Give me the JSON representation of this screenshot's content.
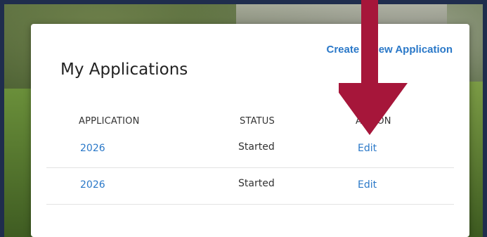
{
  "card": {
    "title": "My Applications",
    "create_link": "Create a New Application"
  },
  "table": {
    "headers": {
      "application": "APPLICATION",
      "status": "STATUS",
      "action": "ACTION"
    },
    "rows": [
      {
        "application": "2026",
        "status": "Started",
        "action": "Edit"
      },
      {
        "application": "2026",
        "status": "Started",
        "action": "Edit"
      }
    ]
  },
  "colors": {
    "link": "#2a78c8",
    "arrow": "#a6163a",
    "frame": "#1f2d4d"
  }
}
